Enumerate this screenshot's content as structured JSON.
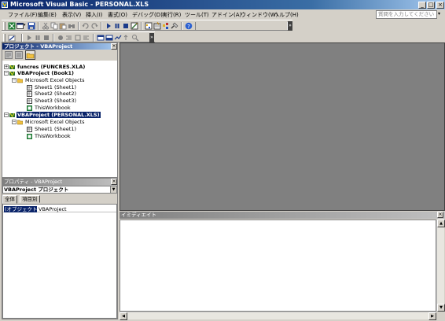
{
  "window": {
    "title": "Microsoft Visual Basic - PERSONAL.XLS",
    "minimize": "_",
    "maximize": "□",
    "close": "×"
  },
  "menu": {
    "items": [
      "ファイル(F)",
      "編集(E)",
      "表示(V)",
      "挿入(I)",
      "書式(O)",
      "デバッグ(D)",
      "実行(R)",
      "ツール(T)",
      "アドイン(A)",
      "ウィンドウ(W)",
      "ヘルプ(H)"
    ],
    "help_placeholder": "質問を入力してください",
    "help_arrow": "▾"
  },
  "project_panel": {
    "title": "プロジェクト - VBAProject",
    "close": "×",
    "tree": [
      {
        "label": "funcres (FUNCRES.XLA)",
        "pm": "+",
        "bold": true
      },
      {
        "label": "VBAProject (Book1)",
        "pm": "−",
        "bold": true
      },
      {
        "label": "Microsoft Excel Objects",
        "pm": "−"
      },
      {
        "label": "Sheet1 (Sheet1)"
      },
      {
        "label": "Sheet2 (Sheet2)"
      },
      {
        "label": "Sheet3 (Sheet3)"
      },
      {
        "label": "ThisWorkbook"
      },
      {
        "label": "VBAProject (PERSONAL.XLS)",
        "pm": "−",
        "bold": true,
        "selected": true
      },
      {
        "label": "Microsoft Excel Objects",
        "pm": "−"
      },
      {
        "label": "Sheet1 (Sheet1)"
      },
      {
        "label": "ThisWorkbook"
      }
    ]
  },
  "properties_panel": {
    "title": "プロパティ - VBAProject",
    "close": "×",
    "combo_value": "VBAProject プロジェクト",
    "combo_arrow": "▼",
    "tabs": [
      "全体",
      "項目別"
    ],
    "rows": [
      {
        "key": "(オブジェクト名)",
        "value": "VBAProject"
      }
    ]
  },
  "immediate_panel": {
    "title": "イミディエイト",
    "close": "×",
    "scroll_up": "▲",
    "scroll_down": "▼",
    "scroll_left": "◀",
    "scroll_right": "▶"
  },
  "toolbar": {
    "chevron": "»"
  },
  "colors": {
    "title_active": "#0a246a",
    "workspace": "#808080",
    "face": "#d4d0c8"
  }
}
